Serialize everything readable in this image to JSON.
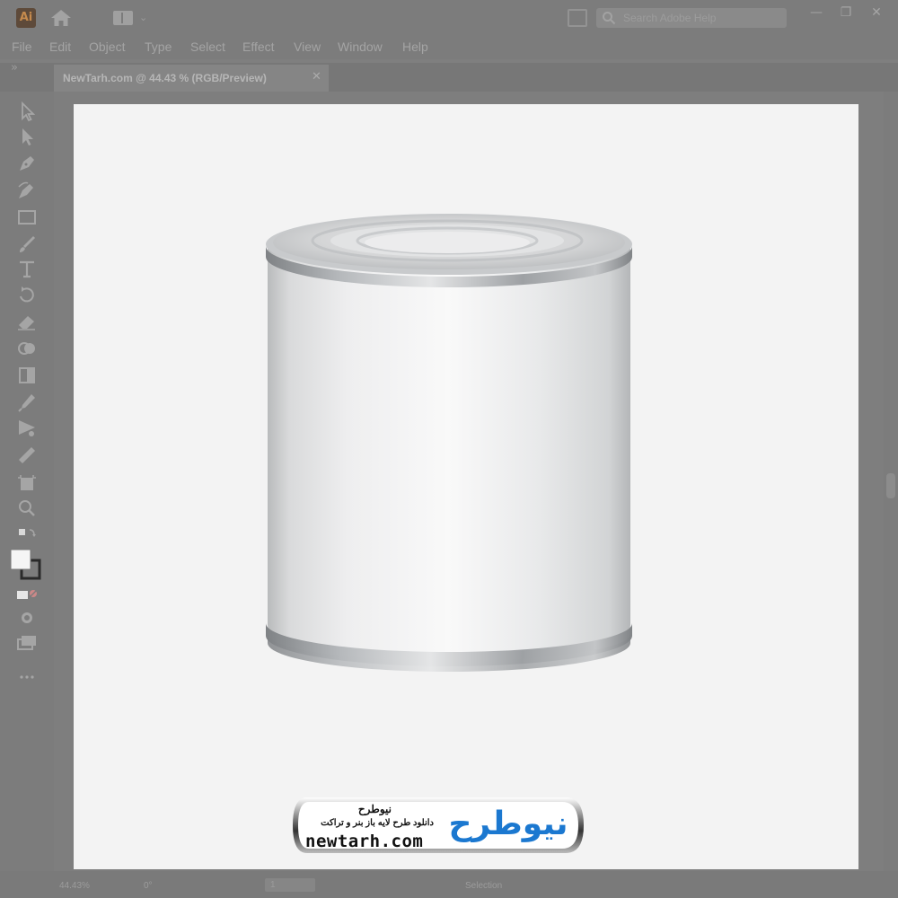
{
  "app": {
    "logo_text": "Ai",
    "workspace_chevron": "⌄",
    "search_placeholder": "Search Adobe Help",
    "window_buttons": [
      "—",
      "❐",
      "✕"
    ],
    "icons": [
      "home-icon",
      "workspace-icon",
      "arrange-documents-icon",
      "search-icon"
    ]
  },
  "menu": [
    "File",
    "Edit",
    "Object",
    "Type",
    "Select",
    "Effect",
    "View",
    "Window",
    "Help"
  ],
  "document_tab": {
    "label": "NewTarh.com @ 44.43 % (RGB/Preview)",
    "close": "✕",
    "collapse": "»"
  },
  "tools": [
    "selection-tool-icon",
    "direct-selection-tool-icon",
    "pen-tool-icon",
    "curvature-tool-icon",
    "rectangle-tool-icon",
    "paintbrush-tool-icon",
    "type-tool-icon",
    "rotate-tool-icon",
    "eraser-tool-icon",
    "shape-builder-tool-icon",
    "gradient-tool-icon",
    "eyedropper-tool-icon",
    "blend-tool-icon",
    "slice-tool-icon",
    "artboard-tool-icon",
    "zoom-tool-icon",
    "swap-colors-icon",
    "fill-stroke-icon",
    "color-mode-icon",
    "draw-mode-icon",
    "screen-mode-icon",
    "more-tools-icon"
  ],
  "status": {
    "zoom": "44.43%",
    "rotate": "0°",
    "artboard_number": "1",
    "tool_name": "Selection"
  },
  "watermark": {
    "title": "نیوطرح",
    "subtitle": "دانلود طرح لایه باز بنر و تراکت",
    "url": "newtarh.com",
    "brand": "نیوطرح",
    "brand_color": "#1b78d0"
  },
  "colors": {
    "ui_gray": "#7c7c7c",
    "artboard": "#f3f3f3"
  }
}
